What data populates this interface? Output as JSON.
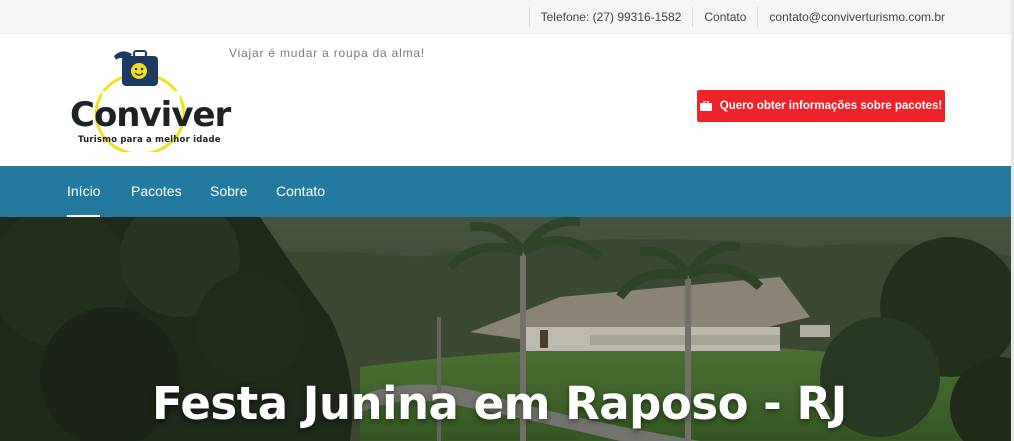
{
  "topbar": {
    "phone": "Telefone: (27) 99316-1582",
    "contact_link": "Contato",
    "email": "contato@conviverturismo.com.br"
  },
  "header": {
    "logo_word": "Conviver",
    "logo_tagline": "Turismo para a melhor idade",
    "slogan": "Viajar é mudar a roupa da alma!",
    "cta_label": "Quero obter informações sobre pacotes!",
    "cta_icon": "suitcase-icon"
  },
  "nav": {
    "items": [
      {
        "label": "Início",
        "active": true
      },
      {
        "label": "Pacotes",
        "active": false
      },
      {
        "label": "Sobre",
        "active": false
      },
      {
        "label": "Contato",
        "active": false
      }
    ]
  },
  "hero": {
    "title": "Festa Junina em Raposo - RJ"
  },
  "colors": {
    "nav_bg": "#24799e",
    "cta_bg": "#ee2229",
    "logo_yellow": "#f4e01a",
    "logo_navy": "#1d3a63"
  }
}
